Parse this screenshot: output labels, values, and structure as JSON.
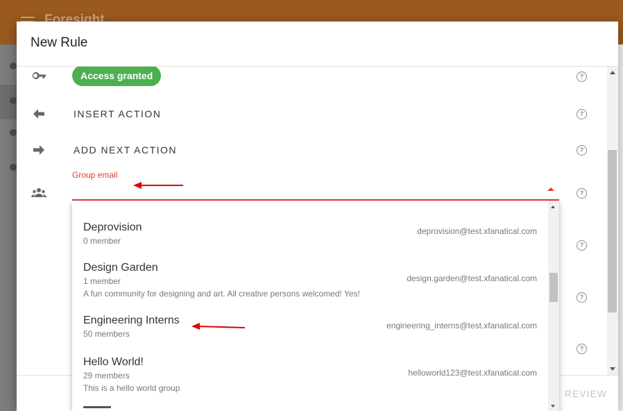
{
  "app": {
    "brand": "Foresight"
  },
  "dialog": {
    "title": "New Rule",
    "chip_label": "Access granted",
    "insert_action_label": "INSERT ACTION",
    "add_next_action_label": "ADD NEXT ACTION",
    "group_email_label": "Group email",
    "group_email_value": "",
    "help_glyph": "?",
    "review_label": "REVIEW"
  },
  "dropdown": {
    "items": [
      {
        "name": "Deprovision",
        "members": "0 member",
        "description": "",
        "email": "deprovision@test.xfanatical.com"
      },
      {
        "name": "Design Garden",
        "members": "1 member",
        "description": "A fun community for designing and art. All creative persons welcomed! Yes!",
        "email": "design.garden@test.xfanatical.com"
      },
      {
        "name": "Engineering Interns",
        "members": "50 members",
        "description": "",
        "email": "engineering_interns@test.xfanatical.com"
      },
      {
        "name": "Hello World!",
        "members": "29 members",
        "description": "This is a hello world group",
        "email": "helloworld123@test.xfanatical.com"
      }
    ]
  },
  "icons": {
    "key": "key-icon",
    "insert": "arrow-left-icon",
    "next": "arrow-right-icon",
    "group": "group-icon",
    "help": "help-circle-icon"
  },
  "colors": {
    "accent_red": "#e53935",
    "chip_green": "#4caf50",
    "appbar": "#9a5a1f"
  }
}
